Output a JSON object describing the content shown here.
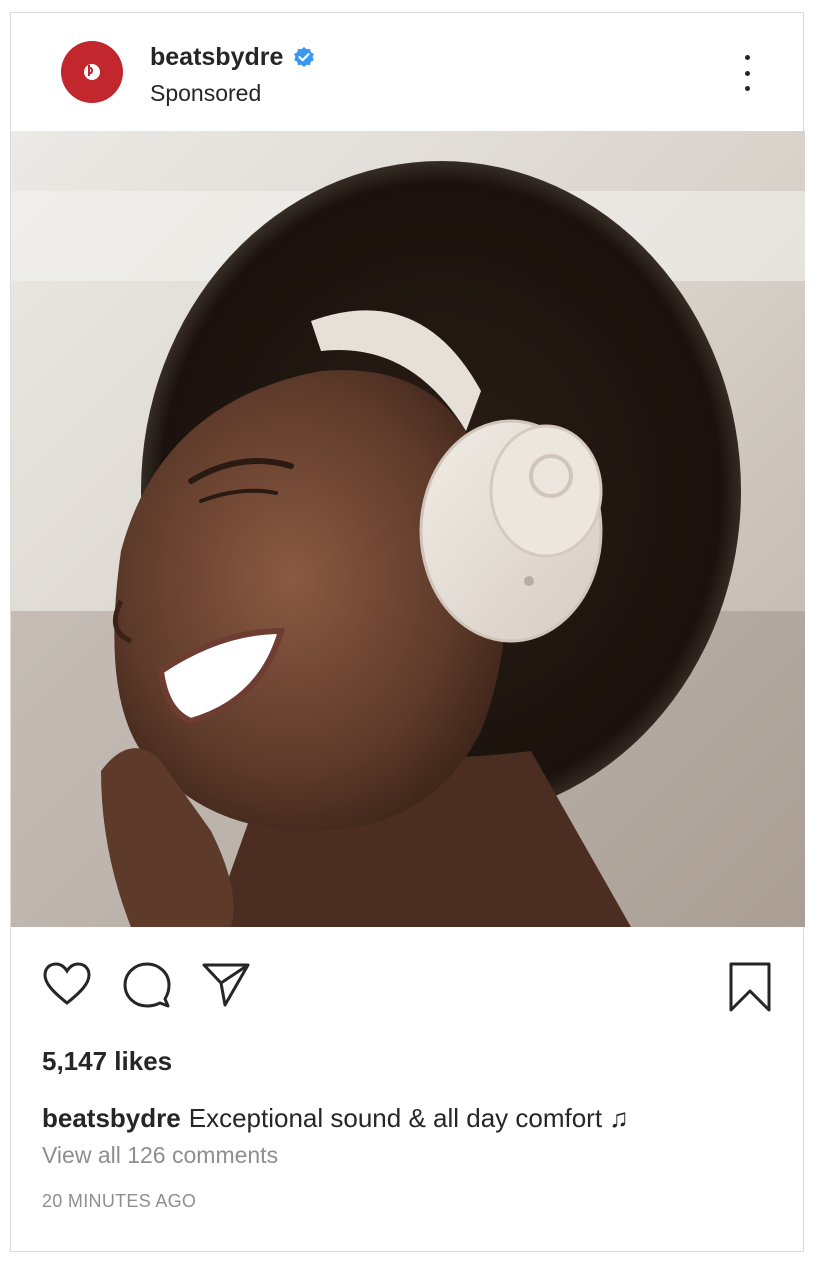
{
  "post": {
    "username": "beatsbydre",
    "subtitle": "Sponsored",
    "verified": true,
    "avatar_icon": "beats-logo-icon",
    "brand_color": "#c1272d",
    "verified_color": "#3897f0",
    "image_description_icon": "post-photo",
    "actions": {
      "like_icon": "heart-icon",
      "comment_icon": "comment-icon",
      "share_icon": "paper-plane-icon",
      "save_icon": "bookmark-icon"
    },
    "likes": "5,147 likes",
    "caption_user": "beatsbydre",
    "caption_text": "Exceptional sound & all day comfort ♫",
    "view_comments": "View all 126 comments",
    "timestamp": "20 MINUTES AGO"
  }
}
